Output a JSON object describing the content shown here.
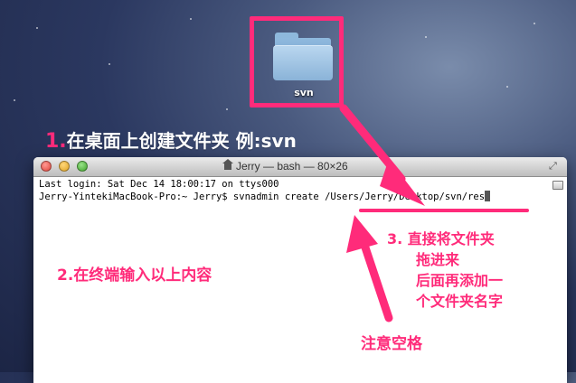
{
  "desktop": {
    "folder_label": "svn"
  },
  "annotations": {
    "step1_number": "1.",
    "step1_text": "在桌面上创建文件夹 例:svn",
    "step2_number": "2.",
    "step2_text": "在终端输入以上内容",
    "step3_number": "3.",
    "step3_lines": [
      "直接将文件夹",
      "拖进来",
      "后面再添加一",
      "个文件夹名字"
    ],
    "note_space": "注意空格",
    "color": "#ff2b7a"
  },
  "terminal": {
    "title": "Jerry — bash — 80×26",
    "lines": [
      "Last login: Sat Dec 14 18:00:17 on ttys000",
      "Jerry-YintekiMacBook-Pro:~ Jerry$ svnadmin create /Users/Jerry/Desktop/svn/res"
    ],
    "traffic_lights": [
      "#e0443a",
      "#dfa323",
      "#3fa42a"
    ]
  },
  "icons": {
    "folder": "folder-icon",
    "home": "home-icon",
    "fullscreen": "fullscreen-icon"
  }
}
